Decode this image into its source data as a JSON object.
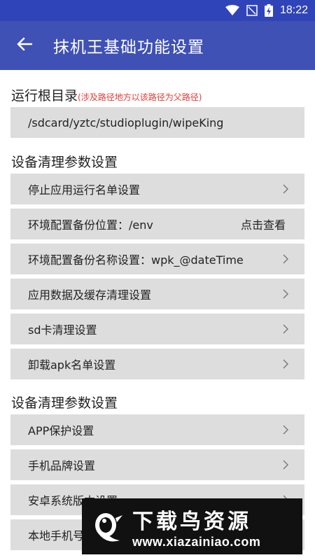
{
  "status_bar": {
    "time": "18:22",
    "icons": [
      "wifi-icon",
      "no-signal-icon",
      "battery-charging-icon"
    ]
  },
  "app_bar": {
    "title": "抹机王基础功能设置",
    "back_icon": "arrow-left-icon"
  },
  "sections": {
    "root_dir": {
      "title": "运行根目录",
      "note": "(涉及路径地方以该路径为父路径)",
      "value": "/sdcard/yztc/studioplugin/wipeKing"
    },
    "device_clean": {
      "title": "设备清理参数设置",
      "items": [
        "停止应用运行名单设置",
        "环境配置备份位置：/env",
        "环境配置备份名称设置：wpk_@dateTime",
        "应用数据及缓存清理设置",
        "sd卡清理设置",
        "卸载apk名单设置"
      ],
      "env_action": "点击查看"
    },
    "device_params": {
      "title": "设备清理参数设置",
      "items": [
        "APP保护设置",
        "手机品牌设置",
        "安卓系统版本设置",
        "本地手机号"
      ]
    }
  },
  "watermark": {
    "name": "下载鸟资源",
    "url": "www.xiazainiao.com"
  },
  "colors": {
    "primary": "#3f51b5",
    "primary_dark": "#3044b9",
    "row_bg": "#dddddd",
    "note_red": "#e53935"
  }
}
